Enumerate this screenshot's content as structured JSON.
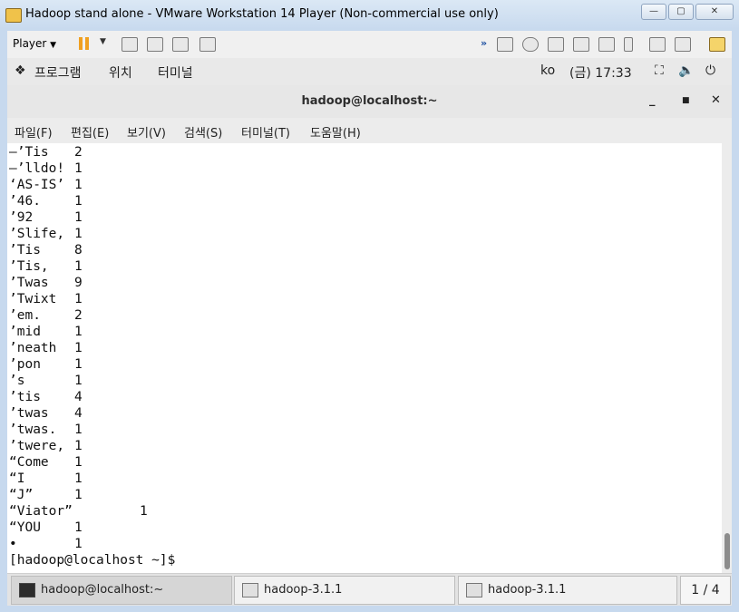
{
  "vm": {
    "title": "Hadoop stand alone - VMware Workstation 14 Player (Non-commercial use only)",
    "player_label": "Player",
    "window_buttons": {
      "minimize": "—",
      "maximize": "▢",
      "close": "✕"
    }
  },
  "gnome_bar": {
    "programs": "프로그램",
    "places": "위치",
    "terminal": "터미널",
    "lang": "ko",
    "clock": "(금) 17:33"
  },
  "terminal": {
    "title": "hadoop@localhost:~",
    "menu": [
      "파일(F)",
      "편집(E)",
      "보기(V)",
      "검색(S)",
      "터미널(T)",
      "도움말(H)"
    ],
    "lines": [
      {
        "word": "—’Tis",
        "count": "2"
      },
      {
        "word": "—’lldo!",
        "count": "1"
      },
      {
        "word": "‘AS-IS’",
        "count": "1"
      },
      {
        "word": "’46.",
        "count": "1"
      },
      {
        "word": "’92",
        "count": "1"
      },
      {
        "word": "’Slife,",
        "count": "1"
      },
      {
        "word": "’Tis",
        "count": "8"
      },
      {
        "word": "’Tis,",
        "count": "1"
      },
      {
        "word": "’Twas",
        "count": "9"
      },
      {
        "word": "’Twixt",
        "count": "1"
      },
      {
        "word": "’em.",
        "count": "2"
      },
      {
        "word": "’mid",
        "count": "1"
      },
      {
        "word": "’neath",
        "count": "1"
      },
      {
        "word": "’pon",
        "count": "1"
      },
      {
        "word": "’s",
        "count": "1"
      },
      {
        "word": "’tis",
        "count": "4"
      },
      {
        "word": "’twas",
        "count": "4"
      },
      {
        "word": "’twas.",
        "count": "1"
      },
      {
        "word": "’twere,",
        "count": "1"
      },
      {
        "word": "“Come",
        "count": "1"
      },
      {
        "word": "“I",
        "count": "1"
      },
      {
        "word": "“J”",
        "count": "1"
      },
      {
        "word": "“Viator”",
        "count": "1"
      },
      {
        "word": "“YOU",
        "count": "1"
      },
      {
        "word": "•",
        "count": "1"
      }
    ],
    "prompt": "[hadoop@localhost ~]$"
  },
  "taskbar": {
    "tasks": [
      "hadoop@localhost:~",
      "hadoop-3.1.1",
      "hadoop-3.1.1"
    ],
    "pager": "1 / 4"
  }
}
